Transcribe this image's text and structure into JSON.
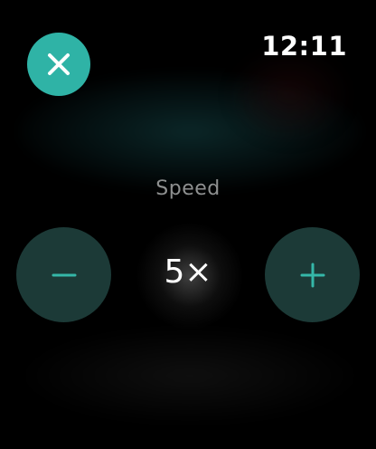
{
  "status_bar": {
    "time": "12:11"
  },
  "controls": {
    "close_icon": "close-icon",
    "label": "Speed",
    "value": "5×",
    "decrease_icon": "minus-icon",
    "increase_icon": "plus-icon"
  },
  "colors": {
    "accent": "#2fb3a6",
    "button_bg": "#1c3a37",
    "button_glyph": "#35b7a8",
    "label_gray": "#8e9090",
    "background": "#000000"
  }
}
